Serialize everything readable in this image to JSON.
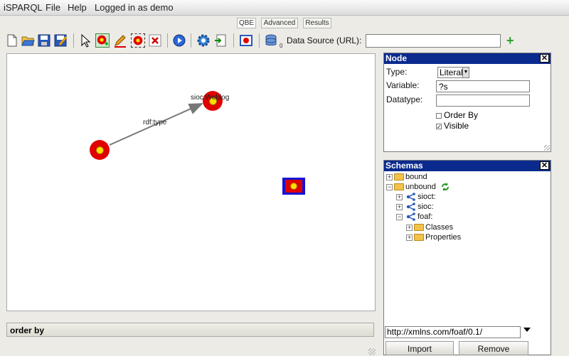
{
  "menubar": {
    "app_name": "iSPARQL",
    "file": "File",
    "help": "Help",
    "login_status": "Logged in as demo"
  },
  "tabs": [
    {
      "label": "QBE",
      "active": true
    },
    {
      "label": "Advanced",
      "active": false
    },
    {
      "label": "Results",
      "active": false
    }
  ],
  "toolbar": {
    "icons": [
      "new-file-icon",
      "open-folder-icon",
      "save-icon",
      "save-as-icon",
      "select-pointer-icon",
      "add-node-icon",
      "edit-pencil-icon",
      "group-icon",
      "delete-icon",
      "run-query-icon",
      "settings-gear-icon",
      "load-icon",
      "clear-canvas-icon",
      "dataset-icon",
      "add-datasource-icon"
    ],
    "dataset_count": "0",
    "data_source_label": "Data Source (URL):",
    "data_source_value": "",
    "add_source_symbol": "+"
  },
  "canvas": {
    "nodes": [
      {
        "name": "subject-node"
      },
      {
        "name": "object-node"
      },
      {
        "name": "literal-node"
      }
    ],
    "labels": {
      "object": "sioc:Weblog",
      "edge": "rdf:type"
    }
  },
  "orderby": {
    "label": "order by"
  },
  "node_panel": {
    "title": "Node",
    "close_symbol": "✕",
    "type_label": "Type:",
    "type_value": "Literal",
    "variable_label": "Variable:",
    "variable_value": "?s",
    "datatype_label": "Datatype:",
    "datatype_value": "",
    "order_by_label": "Order By",
    "order_by_checked": false,
    "visible_label": "Visible",
    "visible_checked": true,
    "checked_mark": "✓"
  },
  "schemas_panel": {
    "title": "Schemas",
    "close_symbol": "✕",
    "tree": [
      {
        "label": "bound",
        "expanded": false,
        "kind": "folder",
        "level": 0
      },
      {
        "label": "unbound",
        "expanded": true,
        "kind": "folder",
        "level": 0
      },
      {
        "label": "sioct:",
        "expanded": false,
        "kind": "namespace",
        "level": 1
      },
      {
        "label": "sioc:",
        "expanded": false,
        "kind": "namespace",
        "level": 1
      },
      {
        "label": "foaf:",
        "expanded": true,
        "kind": "namespace",
        "level": 1
      },
      {
        "label": "Classes",
        "expanded": false,
        "kind": "folder",
        "level": 2
      },
      {
        "label": "Properties",
        "expanded": false,
        "kind": "folder",
        "level": 2
      }
    ],
    "refresh_icon": "refresh-icon",
    "schema_url": "http://xmlns.com/foaf/0.1/",
    "import_label": "Import",
    "remove_label": "Remove"
  },
  "colors": {
    "panel_header": "#0a2a8d",
    "node_red": "#e00000",
    "node_yellow": "#ffde00",
    "literal_border": "#1414d6"
  }
}
